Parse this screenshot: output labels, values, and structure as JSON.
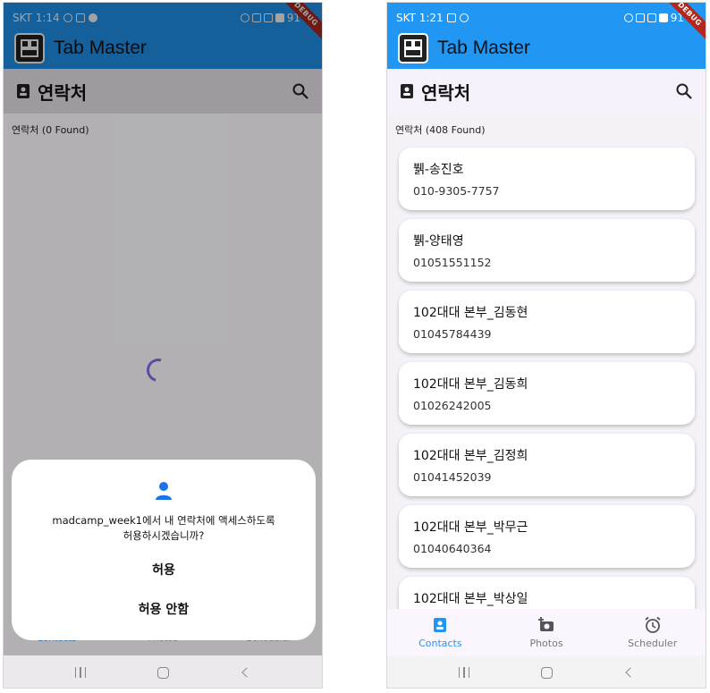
{
  "left": {
    "status": {
      "carrier_time": "SKT 1:14",
      "battery": "91"
    },
    "debug_banner": "DEBUG",
    "app_title": "Tab Master",
    "section_title": "연락처",
    "count_label": "연락처 (0 Found)",
    "dialog": {
      "message_line1": "madcamp_week1에서 내 연락처에 액세스하도록",
      "message_line2": "허용하시겠습니까?",
      "allow_label": "허용",
      "deny_label": "허용 안함"
    },
    "nav_under": [
      "Contacts",
      "Photos",
      "Scheduler"
    ]
  },
  "right": {
    "status": {
      "carrier_time": "SKT 1:21",
      "battery": "91"
    },
    "debug_banner": "DEBUG",
    "app_title": "Tab Master",
    "section_title": "연락처",
    "count_label": "연락처 (408 Found)",
    "contacts": [
      {
        "name": "뷁-송진호",
        "phone": "010-9305-7757"
      },
      {
        "name": "뷁-양태영",
        "phone": "01051551152"
      },
      {
        "name": "102대대 본부_김동현",
        "phone": "01045784439"
      },
      {
        "name": "102대대 본부_김동희",
        "phone": "01026242005"
      },
      {
        "name": "102대대 본부_김정희",
        "phone": "01041452039"
      },
      {
        "name": "102대대 본부_박무근",
        "phone": "01040640364"
      },
      {
        "name": "102대대 본부_박상일",
        "phone": ""
      }
    ],
    "bottom_nav": [
      {
        "label": "Contacts",
        "icon": "contacts-icon",
        "active": true
      },
      {
        "label": "Photos",
        "icon": "add-photo-icon",
        "active": false
      },
      {
        "label": "Scheduler",
        "icon": "alarm-icon",
        "active": false
      }
    ]
  },
  "colors": {
    "primary": "#2196f3",
    "spinner": "#5c4d9d",
    "debug": "#b0281f"
  }
}
